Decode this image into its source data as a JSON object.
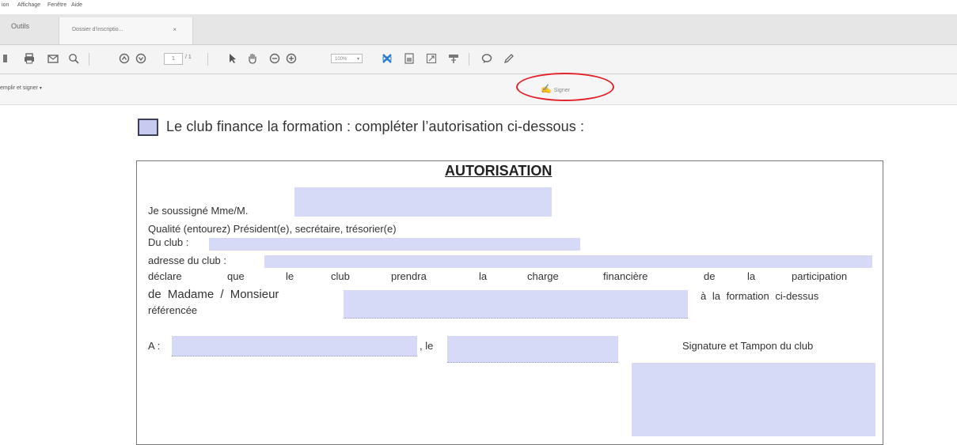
{
  "menu": [
    "ion",
    "Affichage",
    "Fenêtre",
    "Aide"
  ],
  "tabs": {
    "tools": "Outils",
    "document": "Dossier d'inscriptio...",
    "close": "×"
  },
  "toolbar": {
    "icons": [
      "save-icon",
      "print-icon",
      "email-icon",
      "search-icon",
      "page-up-icon",
      "page-down-icon",
      "pointer-icon",
      "hand-icon",
      "zoom-out-icon",
      "zoom-in-icon",
      "crop-icon",
      "export-icon",
      "fit-icon",
      "keyboard-icon",
      "comment-icon",
      "pen-icon"
    ],
    "page_current": "1",
    "page_total": "/ 1",
    "zoom": "100%"
  },
  "signbar": {
    "fill_and_sign": "emplir et signer",
    "sign": "Signer"
  },
  "document": {
    "checkbox_heading": "Le club finance la formation : compléter l’autorisation ci-dessous :",
    "form": {
      "title": "AUTORISATION",
      "soussigne": "Je soussigné Mme/M.",
      "qualite": "Qualité (entourez) Président(e), secrétaire, trésorier(e)",
      "club": "Du club :",
      "adresse": "adresse du club :",
      "declare_words": [
        "déclare",
        "que",
        "le",
        "club",
        "prendra",
        "la",
        "charge",
        "financière",
        "de",
        "la",
        "participation"
      ],
      "de_madame": "de Madame / Monsieur",
      "a_la_formation": "à la formation ci-dessus",
      "referencee": "référencée",
      "a_label": "A :",
      "le_label": ", le",
      "signature": "Signature et Tampon du club"
    }
  },
  "colors": {
    "field_fill": "#d6daf6",
    "annotation_red": "#e3232b"
  }
}
